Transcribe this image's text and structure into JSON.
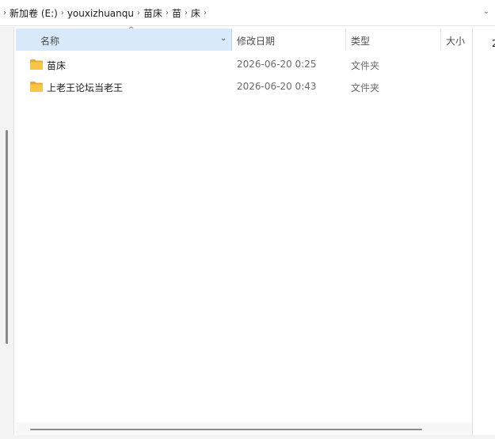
{
  "breadcrumb": {
    "items": [
      "新加卷 (E:)",
      "youxizhuanqu",
      "苗床",
      "苗",
      "床"
    ]
  },
  "columns": {
    "name": "名称",
    "date": "修改日期",
    "type": "类型",
    "size": "大小"
  },
  "files": [
    {
      "name": "苗床",
      "date": "2026-06-20 0:25",
      "type": "文件夹",
      "icon": "folder-icon"
    },
    {
      "name": "上老王论坛当老王",
      "date": "2026-06-20 0:43",
      "type": "文件夹",
      "icon": "folder-icon"
    }
  ],
  "right_edge_text": "2",
  "colors": {
    "header_selected": "#d8eaf9",
    "folder": "#f8c646"
  }
}
